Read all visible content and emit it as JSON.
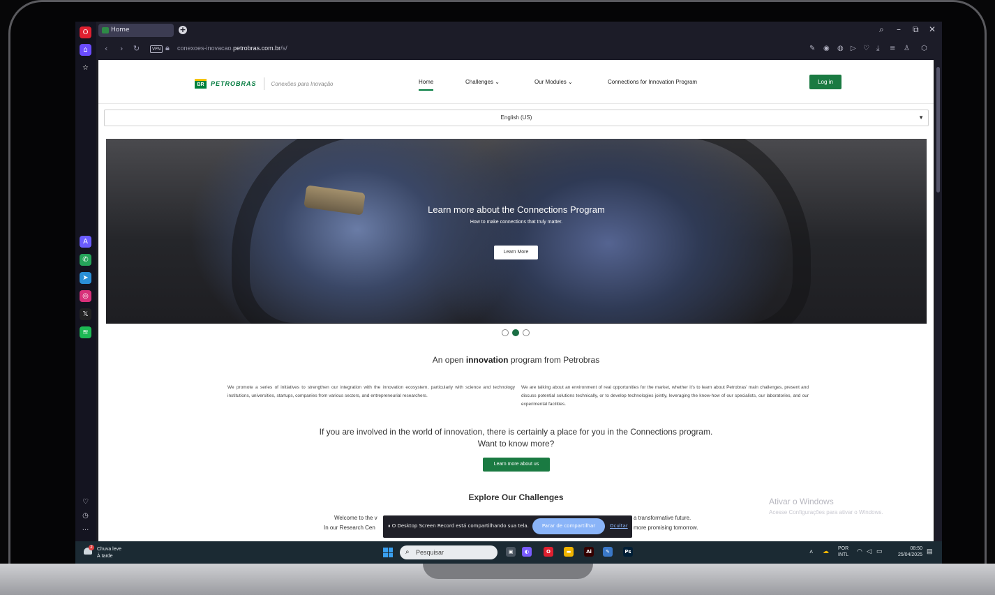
{
  "browser": {
    "tab_title": "Home",
    "tab_favicon_text": "BR",
    "new_tab_icon": "+",
    "vpn_badge": "VPN",
    "url_prefix": "conexoes-inovacao.",
    "url_domain": "petrobras.com.br",
    "url_path": "/s/",
    "window_controls": [
      "⌕",
      "–",
      "⧉",
      "✕"
    ]
  },
  "sidebar": {
    "apps": [
      {
        "name": "opera-logo",
        "glyph": "O",
        "color": "#e02030"
      },
      {
        "name": "home-icon",
        "glyph": "⌂",
        "color": "#6a4cff"
      },
      {
        "name": "bookmark-icon",
        "glyph": "☆",
        "color": "#141420"
      },
      {
        "name": "aria-icon",
        "glyph": "A",
        "color": "#6a5cff"
      },
      {
        "name": "whatsapp-icon",
        "glyph": "✆",
        "color": "#25a35a"
      },
      {
        "name": "telegram-icon",
        "glyph": "➤",
        "color": "#2a8fd8"
      },
      {
        "name": "instagram-icon",
        "glyph": "◎",
        "color": "#d8307a"
      },
      {
        "name": "x-icon",
        "glyph": "𝕏",
        "color": "#222"
      },
      {
        "name": "spotify-icon",
        "glyph": "≋",
        "color": "#1db954"
      }
    ],
    "bottom_icons": [
      "♡",
      "◷",
      "···"
    ]
  },
  "site": {
    "brand": "PETROBRAS",
    "brand_mark": "BR",
    "tagline": "Conexões para Inovação",
    "nav": {
      "home": "Home",
      "challenges": "Challenges",
      "modules": "Our Modules",
      "program": "Connections for Innovation Program"
    },
    "login": "Log in",
    "language": "English (US)",
    "hero": {
      "title": "Learn more about the Connections Program",
      "subtitle": "How to make connections that truly matter.",
      "button": "Learn More",
      "active_slide": 2,
      "slide_count": 3
    },
    "intro": {
      "prefix": "An open",
      "bold": "innovation",
      "suffix": "program from Petrobras"
    },
    "para_left": "We promote a series of initiatives to strengthen our integration with the innovation ecosystem, particularly with science and technology institutions, universities, startups, companies from various sectors, and entrepreneurial researchers.",
    "para_right": "We are talking about an environment of real opportunities for the market, whether it's to learn about Petrobras' main challenges, present and discuss potential solutions technically, or to develop technologies jointly, leveraging the know-how of our specialists, our laboratories, and our experimental facilities.",
    "cta_line1": "If you are involved in the world of innovation, there is certainly a place for you in the Connections program.",
    "cta_line2": "Want to know more?",
    "cta_button": "Learn more about us",
    "explore_title": "Explore Our Challenges",
    "welcome_left1": "Welcome to the v",
    "welcome_left2": "In our Research Cen",
    "welcome_right1": "a transformative future.",
    "welcome_right2": "more promising tomorrow."
  },
  "windows_watermark": {
    "title": "Ativar o Windows",
    "subtitle": "Acesse Configurações para ativar o Windows."
  },
  "screen_share": {
    "message": "O Desktop Screen Record está compartilhando sua tela.",
    "stop_button": "Parar de compartilhar",
    "hide_link": "Ocultar"
  },
  "taskbar": {
    "weather_title": "Chuva leve",
    "weather_sub": "À tarde",
    "weather_badge": "2",
    "search_placeholder": "Pesquisar",
    "lang_top": "POR",
    "lang_bottom": "INTL",
    "time": "08:50",
    "date": "25/04/2025",
    "apps": [
      {
        "name": "task-view-icon",
        "glyph": "▣",
        "color": "#4a5560"
      },
      {
        "name": "copilot-icon",
        "glyph": "◐",
        "color": "#7a5cff"
      },
      {
        "name": "opera-taskbar-icon",
        "glyph": "O",
        "color": "#e02030"
      },
      {
        "name": "file-explorer-icon",
        "glyph": "▬",
        "color": "#f0b400"
      },
      {
        "name": "illustrator-icon",
        "glyph": "Ai",
        "color": "#330000"
      },
      {
        "name": "paint-icon",
        "glyph": "✎",
        "color": "#3a78c8"
      },
      {
        "name": "photoshop-icon",
        "glyph": "Ps",
        "color": "#001e36"
      }
    ]
  }
}
